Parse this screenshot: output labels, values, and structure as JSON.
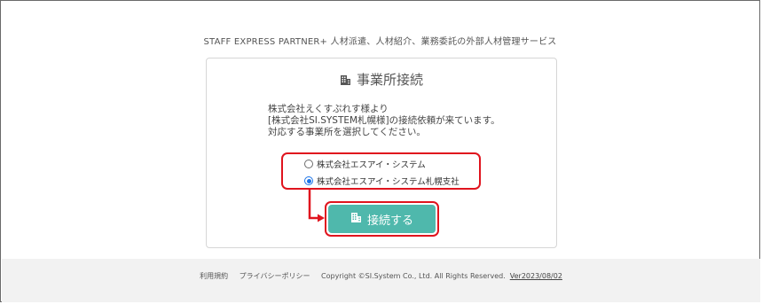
{
  "header": {
    "tagline": "STAFF EXPRESS PARTNER+ 人材派遣、人材紹介、業務委託の外部人材管理サービス"
  },
  "panel": {
    "title": "事業所接続",
    "title_icon": "building-icon",
    "message_lines": [
      "株式会社えくすぷれす様より",
      "[株式会社SI.SYSTEM札幌様]の接続依頼が来ています。",
      "対応する事業所を選択してください。"
    ],
    "options": [
      {
        "label": "株式会社エスアイ・システム",
        "selected": false
      },
      {
        "label": "株式会社エスアイ・システム札幌支社",
        "selected": true
      }
    ],
    "connect_button": {
      "label": "接続する",
      "icon": "building-icon",
      "color": "#4fb8ac"
    }
  },
  "annotation": {
    "highlight_color": "#e0141e"
  },
  "footer": {
    "terms": "利用規約",
    "privacy": "プライバシーポリシー",
    "copyright": "Copyright ©SI.System Co., Ltd. All Rights Reserved.",
    "version": "Ver2023/08/02"
  }
}
